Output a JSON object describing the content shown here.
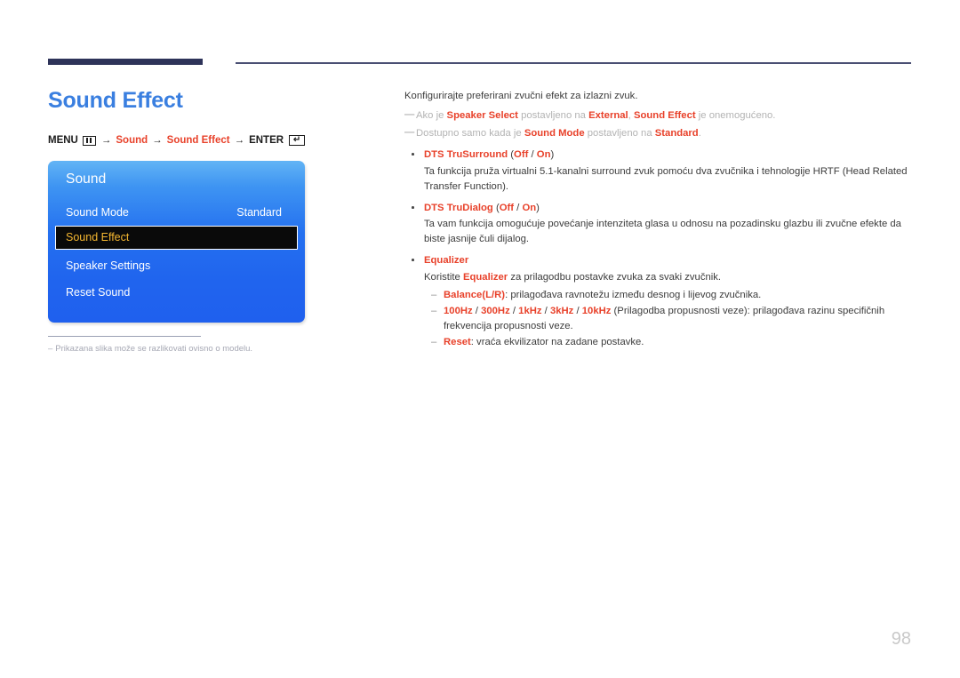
{
  "header": {
    "title": "Sound Effect",
    "breadcrumb": {
      "menu_label": "MENU",
      "menu_icon": "menu-bars-icon",
      "arrow": "→",
      "crumb1": "Sound",
      "crumb2": "Sound Effect",
      "enter_label": "ENTER",
      "enter_icon": "↵"
    }
  },
  "tv_menu": {
    "heading": "Sound",
    "items": [
      {
        "label": "Sound Mode",
        "value": "Standard",
        "selected": false
      },
      {
        "label": "Sound Effect",
        "value": "",
        "selected": true
      },
      {
        "label": "Speaker Settings",
        "value": "",
        "selected": false
      },
      {
        "label": "Reset Sound",
        "value": "",
        "selected": false
      }
    ]
  },
  "footnote": {
    "dash": "–",
    "text": "Prikazana slika može se razlikovati ovisno o modelu."
  },
  "content": {
    "intro": "Konfigurirajte preferirani zvučni efekt za izlazni zvuk.",
    "notes": [
      {
        "dash": "—",
        "p1": "Ako je ",
        "hl1": "Speaker Select",
        "p2": " postavljeno na ",
        "hl2": "External",
        "p3": ", ",
        "hl3": "Sound Effect",
        "p4": " je onemogućeno."
      },
      {
        "dash": "—",
        "p1": "Dostupno samo kada je ",
        "hl1": "Sound Mode",
        "p2": " postavljeno na ",
        "hl2": "Standard",
        "p3": ".",
        "hl3": "",
        "p4": ""
      }
    ],
    "bullets": [
      {
        "title": "DTS TruSurround",
        "options_open": " (",
        "option_a": "Off",
        "options_sep": " / ",
        "option_b": "On",
        "options_close": ")",
        "body": "Ta funkcija pruža virtualni 5.1-kanalni surround zvuk pomoću dva zvučnika i tehnologije HRTF (Head Related Transfer Function)."
      },
      {
        "title": "DTS TruDialog",
        "options_open": " (",
        "option_a": "Off",
        "options_sep": " / ",
        "option_b": "On",
        "options_close": ")",
        "body": "Ta vam funkcija omogućuje povećanje intenziteta glasa u odnosu na pozadinsku glazbu ili zvučne efekte da biste jasnije čuli dijalog."
      }
    ],
    "equalizer": {
      "title": "Equalizer",
      "body_p1": "Koristite ",
      "body_hl": "Equalizer",
      "body_p2": " za prilagodbu postavke zvuka za svaki zvučnik.",
      "sub_items": [
        {
          "dash": "–",
          "hl": "Balance(L/R)",
          "text": ": prilagođava ravnotežu između desnog i lijevog zvučnika."
        },
        {
          "dash": "–",
          "hl": "100Hz",
          "hl_sep1": " / ",
          "hl2": "300Hz",
          "hl_sep2": " / ",
          "hl3": "1kHz",
          "hl_sep3": " / ",
          "hl4": "3kHz",
          "hl_sep4": " / ",
          "hl5": "10kHz",
          "text": " (Prilagodba propusnosti veze): prilagođava razinu specifičnih frekvencija propusnosti veze."
        },
        {
          "dash": "–",
          "hl": "Reset",
          "text": ": vraća ekvilizator na zadane postavke."
        }
      ]
    }
  },
  "page_number": "98"
}
